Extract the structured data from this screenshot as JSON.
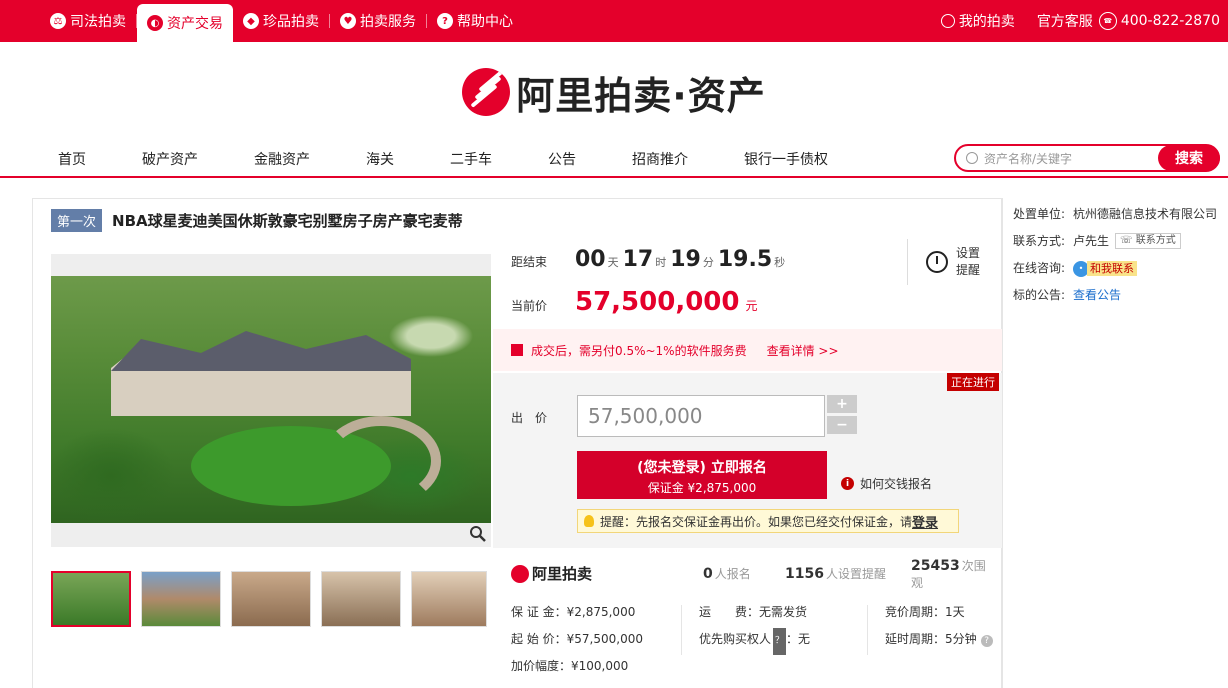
{
  "topnav": {
    "items": [
      {
        "label": "司法拍卖",
        "icon": "gavel-icon"
      },
      {
        "label": "资产交易",
        "icon": "asset-icon",
        "active": true
      },
      {
        "label": "珍品拍卖",
        "icon": "gem-icon"
      },
      {
        "label": "拍卖服务",
        "icon": "heart-icon"
      },
      {
        "label": "帮助中心",
        "icon": "question-icon"
      }
    ],
    "my_auction": "我的拍卖",
    "service": "官方客服",
    "phone": "400-822-2870"
  },
  "logo": {
    "text": "阿里拍卖·资产"
  },
  "mainnav": {
    "items": [
      "首页",
      "破产资产",
      "金融资产",
      "海关",
      "二手车",
      "公告",
      "招商推介",
      "银行一手债权"
    ],
    "search_placeholder": "资产名称/关键字",
    "search_button": "搜索"
  },
  "item": {
    "round": "第一次",
    "title": "NBA球星麦迪美国休斯敦豪宅别墅房子房产豪宅麦蒂"
  },
  "timer": {
    "label": "距结束",
    "days": "00",
    "days_unit": "天",
    "hours": "17",
    "hours_unit": "时",
    "minutes": "19",
    "minutes_unit": "分",
    "seconds": "19.5",
    "seconds_unit": "秒",
    "remind": "设置提醒"
  },
  "price": {
    "label": "当前价",
    "value": "57,500,000",
    "unit": "元"
  },
  "fee": {
    "text": "成交后，需另付0.5%~1%的软件服务费",
    "detail": "查看详情 >>"
  },
  "bid": {
    "status": "正在进行",
    "label": "出　价",
    "value": "57,500,000",
    "plus": "+",
    "minus": "−",
    "signup_main": "(您未登录) 立即报名",
    "signup_sub": "保证金 ¥2,875,000",
    "how": "如何交钱报名",
    "tip": "提醒：先报名交保证金再出价。如果您已经交付保证金，请",
    "tip_login": "登录"
  },
  "stats": {
    "brand": "阿里拍卖",
    "signups": "0",
    "signups_label": "人报名",
    "reminders": "1156",
    "reminders_label": "人设置提醒",
    "views": "25453",
    "views_label": "次围观"
  },
  "info": {
    "deposit": "保 证 金：¥2,875,000",
    "start": "起 始 价：¥57,500,000",
    "increment": "加价幅度：¥100,000",
    "shipping": "运　　费：无需发货",
    "priority_label": "优先购买权人",
    "priority_badge": "？",
    "priority_value": "：无",
    "cycle": "竞价周期：1天",
    "delay": "延时周期：5分钟"
  },
  "side": {
    "unit_label": "处置单位:",
    "unit_value": "杭州德融信息技术有限公司",
    "contact_label": "联系方式:",
    "contact_value": "卢先生",
    "contact_btn": "联系方式",
    "chat_label": "在线咨询:",
    "chat_btn": "和我联系",
    "notice_label": "标的公告:",
    "notice_link": "查看公告"
  }
}
